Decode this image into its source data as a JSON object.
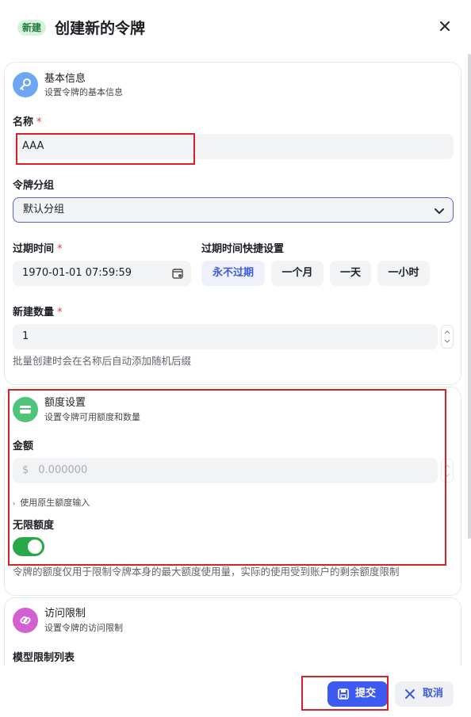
{
  "header": {
    "badge": "新建",
    "title": "创建新的令牌"
  },
  "basic": {
    "title": "基本信息",
    "subtitle": "设置令牌的基本信息",
    "name_label": "名称",
    "name_value": "AAA",
    "group_label": "令牌分组",
    "group_value": "默认分组",
    "expire_label": "过期时间",
    "expire_value": "1970-01-01 07:59:59",
    "quick_label": "过期时间快捷设置",
    "quick_options": [
      "永不过期",
      "一个月",
      "一天",
      "一小时"
    ],
    "count_label": "新建数量",
    "count_value": "1",
    "count_hint": "批量创建时会在名称后自动添加随机后缀",
    "required_mark": "*"
  },
  "quota": {
    "title": "额度设置",
    "subtitle": "设置令牌可用额度和数量",
    "amount_label": "金额",
    "currency": "$",
    "amount_placeholder": "0.000000",
    "raw_toggle": "使用原生额度输入",
    "unlimited_label": "无限额度",
    "unlimited_on": true,
    "note": "令牌的额度仅用于限制令牌本身的最大额度使用量，实际的使用受到账户的剩余额度限制"
  },
  "access": {
    "title": "访问限制",
    "subtitle": "设置令牌的访问限制",
    "model_list_label": "模型限制列表"
  },
  "footer": {
    "submit": "提交",
    "cancel": "取消"
  },
  "colors": {
    "primary": "#3d5af1",
    "toggle_on": "#29a84a",
    "required": "#e33e3e",
    "highlight": "#d9202a"
  }
}
